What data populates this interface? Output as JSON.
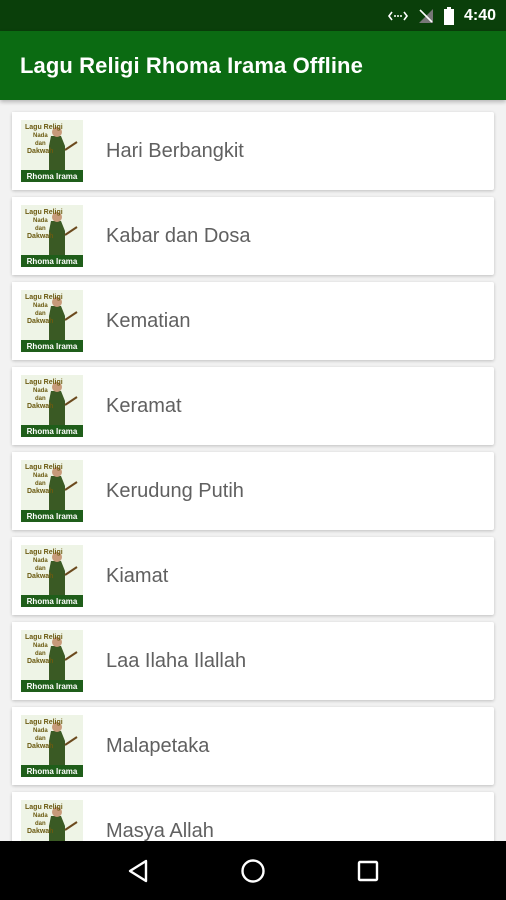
{
  "status_bar": {
    "time": "4:40",
    "icons": [
      "data-sync-icon",
      "no-signal-icon",
      "battery-icon"
    ]
  },
  "app_bar": {
    "title": "Lagu Religi Rhoma Irama Offline"
  },
  "colors": {
    "status_bar": "#0a3f0a",
    "app_bar": "#0b6b12",
    "list_background": "#f2f2f2",
    "item_text": "#606060"
  },
  "thumbnail": {
    "title_lines": [
      "Lagu Religi",
      "Nada",
      "dan",
      "Dakwah"
    ],
    "banner": "Rhoma Irama"
  },
  "songs": [
    "Hari Berbangkit",
    "Kabar dan Dosa",
    "Kematian",
    "Keramat",
    "Kerudung Putih",
    "Kiamat",
    "Laa Ilaha Ilallah",
    "Malapetaka",
    "Masya Allah"
  ],
  "nav_bar": {
    "buttons": [
      "back-icon",
      "home-icon",
      "recents-icon"
    ]
  }
}
